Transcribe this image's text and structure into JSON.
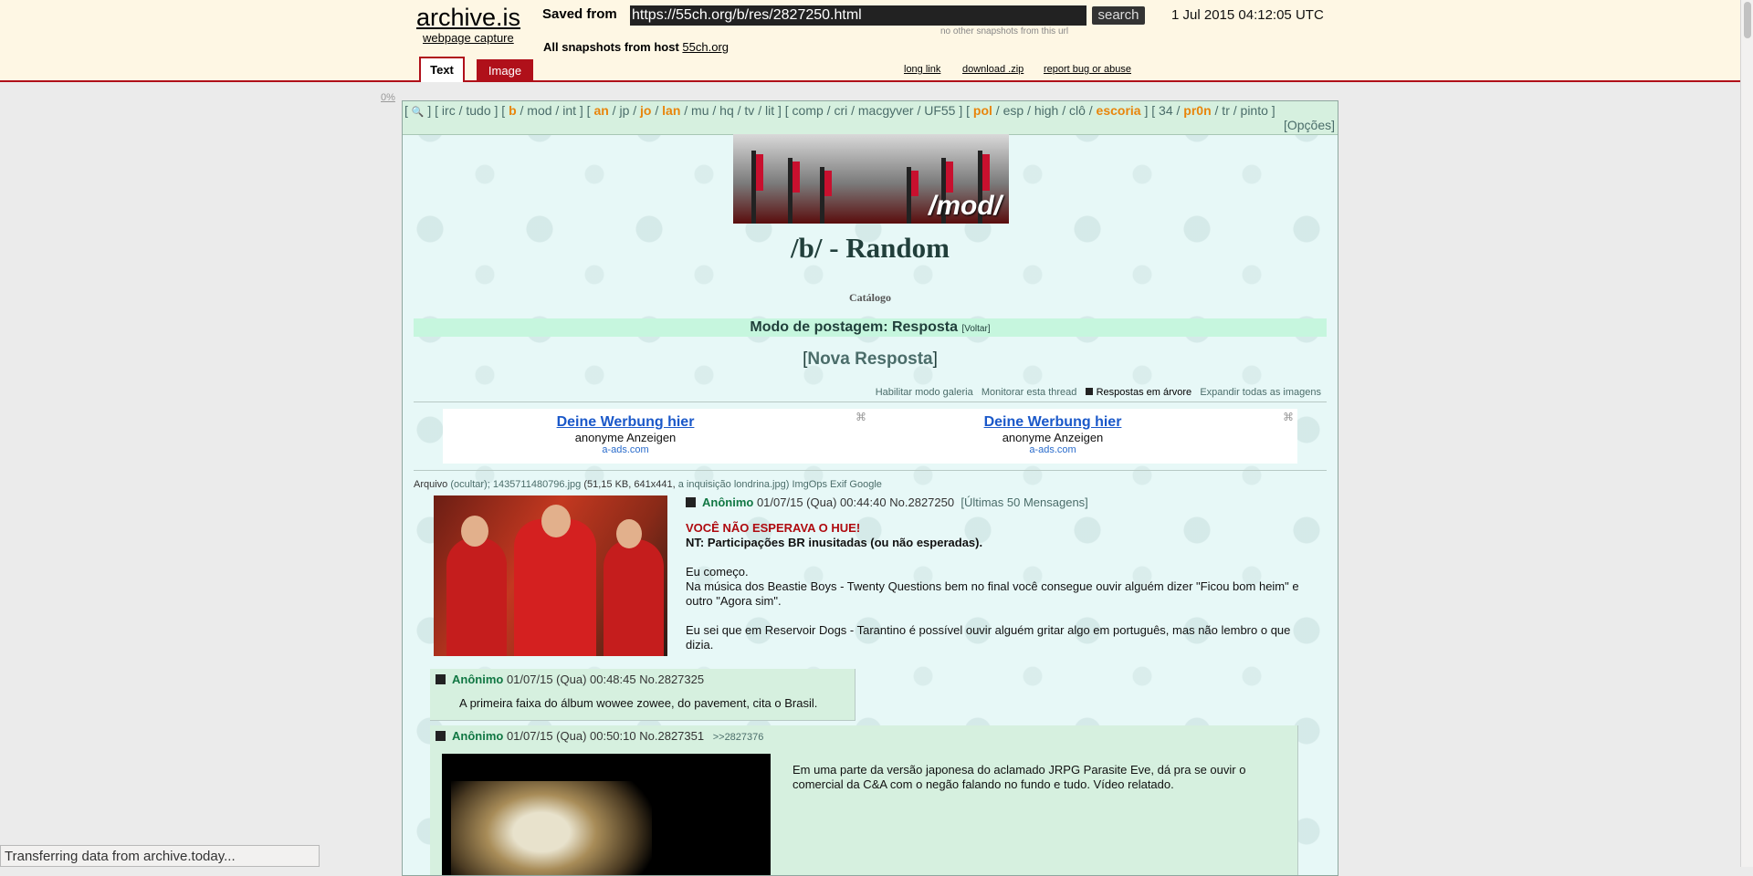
{
  "archive": {
    "logo": "archive.is",
    "logo_sub": "webpage capture",
    "saved_from_label": "Saved from",
    "url": "https://55ch.org/b/res/2827250.html",
    "search_label": "search",
    "no_other": "no other snapshots from this url",
    "date": "1 Jul 2015 04:12:05 UTC",
    "all_snapshots_label": "All snapshots from host",
    "host": "55ch.org",
    "links": {
      "long_link": "long link",
      "download": "download .zip",
      "report": "report bug or abuse"
    },
    "tabs": {
      "text": "Text",
      "image": "Image"
    },
    "progress": "0%"
  },
  "board": {
    "boardlist_parts": [
      {
        "t": "[ ",
        "hl": false
      },
      {
        "t": "🔍",
        "hl": false
      },
      {
        "t": " ] [ irc / tudo ] [ ",
        "hl": false
      },
      {
        "t": "b",
        "hl": true
      },
      {
        "t": " / mod / int ] [ ",
        "hl": false
      },
      {
        "t": "an",
        "hl": true
      },
      {
        "t": " / jp / ",
        "hl": false
      },
      {
        "t": "jo",
        "hl": true
      },
      {
        "t": " / ",
        "hl": false
      },
      {
        "t": "lan",
        "hl": true
      },
      {
        "t": " / mu / hq / tv / lit ] [ comp / cri / macgyver / UF55 ] [ ",
        "hl": false
      },
      {
        "t": "pol",
        "hl": true
      },
      {
        "t": " / esp / high / clô / ",
        "hl": false
      },
      {
        "t": "escoria",
        "hl": true
      },
      {
        "t": " ] [ 34 / ",
        "hl": false
      },
      {
        "t": "pr0n",
        "hl": true
      },
      {
        "t": " / tr / pinto ]",
        "hl": false
      }
    ],
    "opcoes": "[Opções]",
    "banner_text": "/mod/",
    "title": "/b/ - Random",
    "catalogo": "Catálogo",
    "mode": "Modo de postagem: Resposta",
    "voltar": "[Voltar]",
    "nova_open": "[",
    "nova": "Nova Resposta",
    "nova_close": "]",
    "options": {
      "galeria": "Habilitar modo galeria",
      "monitorar": "Monitorar esta thread",
      "arvore": "Respostas em árvore",
      "expandir": "Expandir todas as imagens"
    }
  },
  "ads": [
    {
      "title": "Deine Werbung hier",
      "sub": "anonyme Anzeigen",
      "url": "a-ads.com"
    },
    {
      "title": "Deine Werbung hier",
      "sub": "anonyme Anzeigen",
      "url": "a-ads.com"
    }
  ],
  "op": {
    "file_label": "Arquivo",
    "file_hide": "(ocultar);",
    "file_name": "1435711480796.jpg",
    "file_meta": "(51,15 KB, 641x441,",
    "file_orig": "a inquisição londrina.jpg)",
    "file_tools": "ImgOps Exif Google",
    "name": "Anônimo",
    "date": "01/07/15 (Qua) 00:44:40",
    "no": "No.2827250",
    "last50": "[Últimas 50 Mensagens]",
    "line1": "VOCÊ NÃO ESPERAVA O HUE!",
    "line2": "NT: Participações BR inusitadas (ou não esperadas).",
    "line3": "Eu começo.",
    "line4": "Na música dos Beastie Boys - Twenty Questions bem no final você consegue ouvir alguém dizer \"Ficou bom heim\" e outro \"Agora sim\".",
    "line5": "Eu sei que em Reservoir Dogs - Tarantino é possível ouvir alguém gritar algo em português, mas não lembro o que dizia."
  },
  "replies": [
    {
      "name": "Anônimo",
      "date": "01/07/15 (Qua) 00:48:45",
      "no": "No.2827325",
      "body": "A primeira faixa do álbum wowee zowee, do pavement, cita o Brasil."
    },
    {
      "name": "Anônimo",
      "date": "01/07/15 (Qua) 00:50:10",
      "no": "No.2827351",
      "backlink": ">>2827376",
      "body": "Em uma parte da versão japonesa do aclamado JRPG Parasite Eve, dá pra se ouvir o comercial da C&A com o negão falando no fundo e tudo. Vídeo relatado."
    }
  ],
  "status": "Transferring data from archive.today..."
}
